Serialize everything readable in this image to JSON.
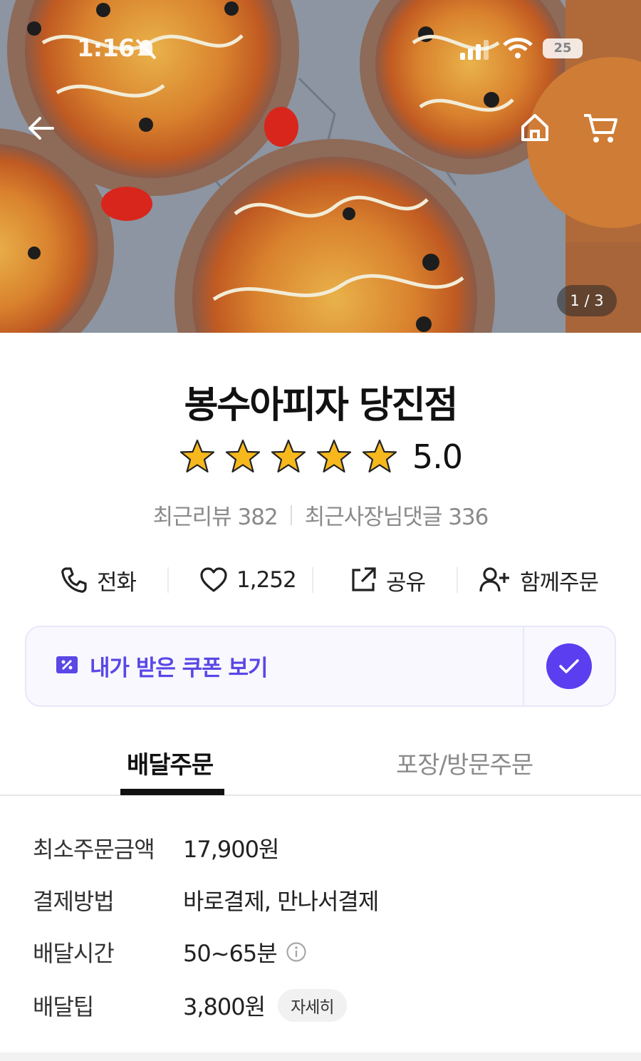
{
  "status_bar": {
    "time": "1:16",
    "battery": "25"
  },
  "hero": {
    "image_counter": "1 / 3"
  },
  "store": {
    "name": "봉수아피자 당진점",
    "rating": "5.0",
    "rating_stars": 5,
    "recent_reviews": "최근리뷰 382",
    "recent_owner_replies": "최근사장님댓글 336"
  },
  "actions": {
    "call": "전화",
    "likes": "1,252",
    "share": "공유",
    "group_order": "함께주문"
  },
  "coupon": {
    "label": "내가 받은 쿠폰 보기"
  },
  "tabs": {
    "delivery": "배달주문",
    "pickup": "포장/방문주문",
    "active": "delivery"
  },
  "info": [
    {
      "label": "최소주문금액",
      "value": "17,900원"
    },
    {
      "label": "결제방법",
      "value": "바로결제, 만나서결제"
    },
    {
      "label": "배달시간",
      "value": "50~65분"
    },
    {
      "label": "배달팁",
      "value": "3,800원",
      "detail": "자세히"
    }
  ],
  "colors": {
    "accent": "#5b3ef0",
    "coupon_text": "#5a47e6",
    "star": "#f6b81c"
  }
}
